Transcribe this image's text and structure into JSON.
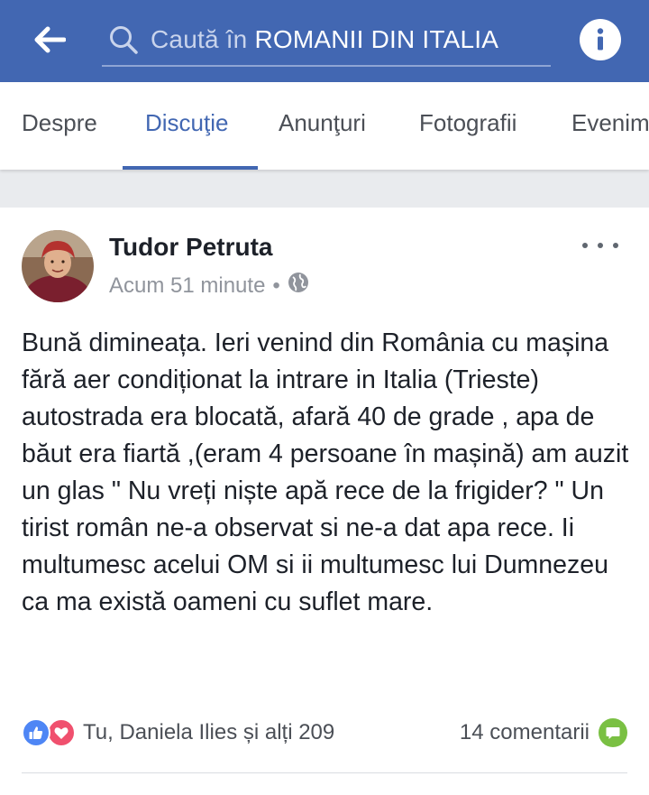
{
  "search": {
    "prefix": "Caută în",
    "group": "ROMANII DIN ITALIA"
  },
  "tabs": [
    {
      "label": "Despre",
      "active": false
    },
    {
      "label": "Discuţie",
      "active": true
    },
    {
      "label": "Anunţuri",
      "active": false
    },
    {
      "label": "Fotografii",
      "active": false
    },
    {
      "label": "Evenim",
      "active": false
    }
  ],
  "post": {
    "author": "Tudor Petruta",
    "time": "Acum 51 minute",
    "privacy_icon": "globe-icon",
    "text": "Bună dimineața. Ieri venind din România cu mașina fără aer condiționat la intrare in Italia (Trieste) autostrada era blocată, afară 40 de grade , apa de băut era fiartă  ,(eram 4 persoane în mașină) am auzit un glas \" Nu vreți niște apă rece de la frigider? \" Un tirist român ne-a observat si ne-a dat apa rece. Ii multumesc acelui OM si ii multumesc lui Dumnezeu ca ma există oameni cu suflet mare.",
    "reactions_text": "Tu, Daniela Ilies și alți 209",
    "comments_text": "14 comentarii"
  },
  "colors": {
    "brand": "#4267b2",
    "like": "#4e86f5",
    "love": "#f0506e",
    "comment": "#7ac043"
  }
}
